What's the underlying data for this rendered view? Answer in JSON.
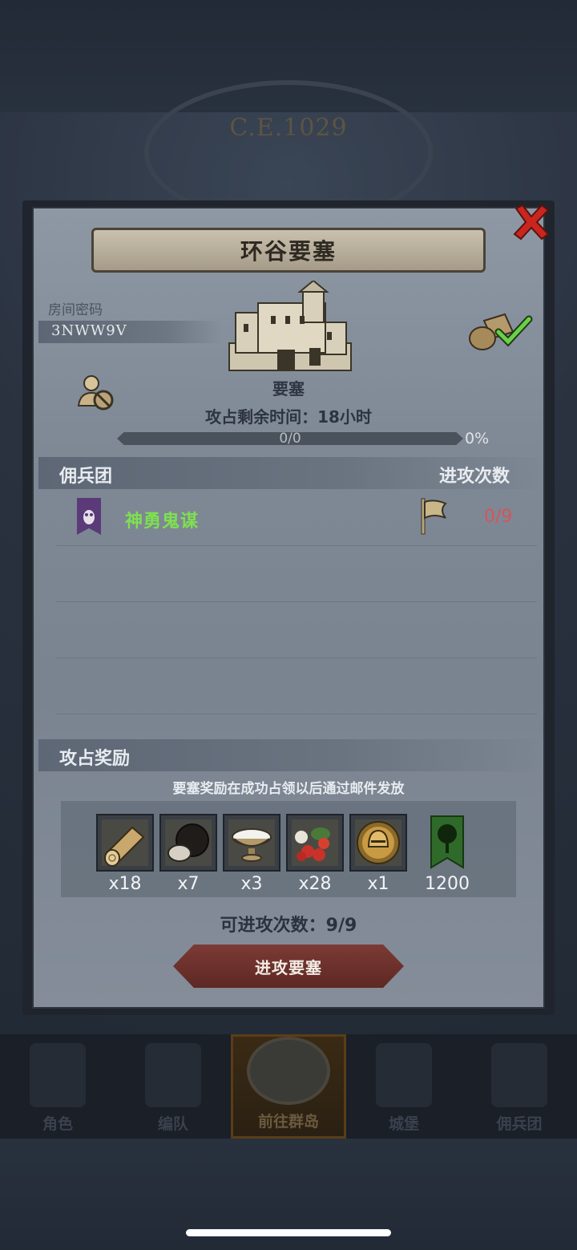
{
  "header": {
    "era": "C.E.1029"
  },
  "modal": {
    "title": "环谷要塞",
    "room": {
      "label": "房间密码",
      "code": "3NWW9V"
    },
    "fortress": {
      "label": "要塞",
      "remaining_time": "攻占剩余时间：18小时",
      "progress_text": "0/0",
      "progress_percent_text": "0%",
      "progress_fraction": 0
    },
    "guild_section": {
      "title": "佣兵团",
      "attacks_header": "进攻次数",
      "rows": [
        {
          "name": "神勇鬼谋",
          "attacks": "0/9",
          "banner_color": "#5a3a78"
        }
      ]
    },
    "rewards_section": {
      "title": "攻占奖励",
      "note": "要塞奖励在成功占领以后通过邮件发放",
      "items": [
        {
          "icon": "wood-log-icon",
          "count": "x18"
        },
        {
          "icon": "truffle-icon",
          "count": "x7"
        },
        {
          "icon": "salt-bowl-icon",
          "count": "x3"
        },
        {
          "icon": "berries-icon",
          "count": "x28"
        },
        {
          "icon": "knight-helmet-coin-icon",
          "count": "x1"
        },
        {
          "icon": "tree-banner-icon",
          "count": "1200"
        }
      ]
    },
    "attacks_available": "可进攻次数：9/9",
    "attack_button": "进攻要塞"
  },
  "nav": {
    "items": [
      {
        "label": "角色",
        "active": false
      },
      {
        "label": "编队",
        "active": false
      },
      {
        "label": "前往群岛",
        "active": true
      },
      {
        "label": "城堡",
        "active": false
      },
      {
        "label": "佣兵团",
        "active": false
      }
    ]
  },
  "colors": {
    "guild_name": "#7ee050",
    "attack_count": "#d2565a",
    "close_icon": "#c8261e",
    "attack_button": "#6e302b"
  }
}
